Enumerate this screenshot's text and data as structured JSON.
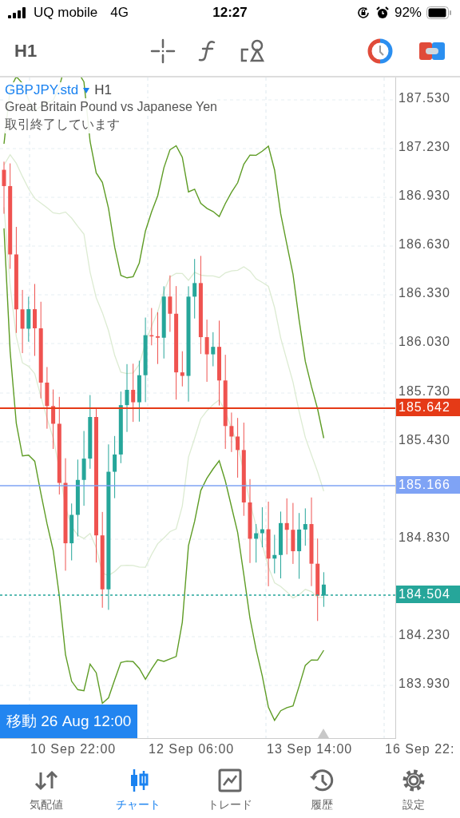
{
  "status_bar": {
    "carrier": "UQ mobile",
    "network": "4G",
    "time": "12:27",
    "battery": "92%"
  },
  "toolbar": {
    "timeframe": "H1"
  },
  "chart": {
    "symbol": "GBPJPY.std",
    "timeframe": "H1",
    "description": "Great Britain Pound vs Japanese Yen",
    "status": "取引終了しています",
    "price_axis": [
      "187.530",
      "187.230",
      "186.930",
      "186.630",
      "186.330",
      "186.030",
      "185.730",
      "185.430",
      "184.830",
      "184.230",
      "183.930"
    ],
    "price_lines": [
      {
        "label": "185.642",
        "color": "#e53a17"
      },
      {
        "label": "185.166",
        "color": "#7fa3f5"
      },
      {
        "label": "184.504",
        "color": "#26a69a"
      }
    ],
    "time_axis": [
      "10 Sep 22:00",
      "12 Sep 06:00",
      "13 Sep 14:00",
      "16 Sep 22:"
    ],
    "goto_label": "移動 26 Aug 12:00"
  },
  "tabs": [
    {
      "label": "気配値",
      "selected": false
    },
    {
      "label": "チャート",
      "selected": true
    },
    {
      "label": "トレード",
      "selected": false
    },
    {
      "label": "履歴",
      "selected": false
    },
    {
      "label": "設定",
      "selected": false
    }
  ]
}
